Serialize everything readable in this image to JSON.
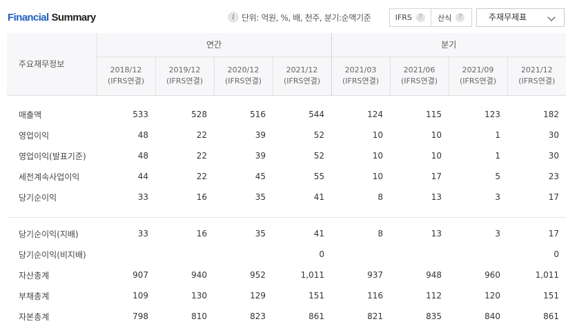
{
  "header": {
    "title_part1": "Financial",
    "title_part2": "Summary",
    "info_icon": "info-icon",
    "unit_text": "단위: 억원, %, 배, 천주, 분기:순액기준",
    "toggle_ifrs": "IFRS",
    "toggle_calc": "산식",
    "help_glyph": "?",
    "dropdown_value": "주재무제표"
  },
  "table": {
    "row_header": "주요재무정보",
    "group_annual": "연간",
    "group_quarter": "분기",
    "columns": [
      {
        "period": "2018/12",
        "basis": "(IFRS연결)"
      },
      {
        "period": "2019/12",
        "basis": "(IFRS연결)"
      },
      {
        "period": "2020/12",
        "basis": "(IFRS연결)"
      },
      {
        "period": "2021/12",
        "basis": "(IFRS연결)"
      },
      {
        "period": "2021/03",
        "basis": "(IFRS연결)"
      },
      {
        "period": "2021/06",
        "basis": "(IFRS연결)"
      },
      {
        "period": "2021/09",
        "basis": "(IFRS연결)"
      },
      {
        "period": "2021/12",
        "basis": "(IFRS연결)"
      }
    ],
    "rows": [
      {
        "label": "매출액",
        "values": [
          "533",
          "528",
          "516",
          "544",
          "124",
          "115",
          "123",
          "182"
        ]
      },
      {
        "label": "영업이익",
        "values": [
          "48",
          "22",
          "39",
          "52",
          "10",
          "10",
          "1",
          "30"
        ]
      },
      {
        "label": "영업이익(발표기준)",
        "values": [
          "48",
          "22",
          "39",
          "52",
          "10",
          "10",
          "1",
          "30"
        ]
      },
      {
        "label": "세전계속사업이익",
        "values": [
          "44",
          "22",
          "45",
          "55",
          "10",
          "17",
          "5",
          "23"
        ]
      },
      {
        "label": "당기순이익",
        "values": [
          "33",
          "16",
          "35",
          "41",
          "8",
          "13",
          "3",
          "17"
        ]
      },
      {
        "label": "당기순이익(지배)",
        "values": [
          "33",
          "16",
          "35",
          "41",
          "8",
          "13",
          "3",
          "17"
        ]
      },
      {
        "label": "당기순이익(비지배)",
        "values": [
          "",
          "",
          "",
          "0",
          "",
          "",
          "",
          "0"
        ]
      },
      {
        "label": "자산총계",
        "values": [
          "907",
          "940",
          "952",
          "1,011",
          "937",
          "948",
          "960",
          "1,011"
        ]
      },
      {
        "label": "부채총계",
        "values": [
          "109",
          "130",
          "129",
          "151",
          "116",
          "112",
          "120",
          "151"
        ]
      },
      {
        "label": "자본총계",
        "values": [
          "798",
          "810",
          "823",
          "861",
          "821",
          "835",
          "840",
          "861"
        ]
      }
    ]
  }
}
